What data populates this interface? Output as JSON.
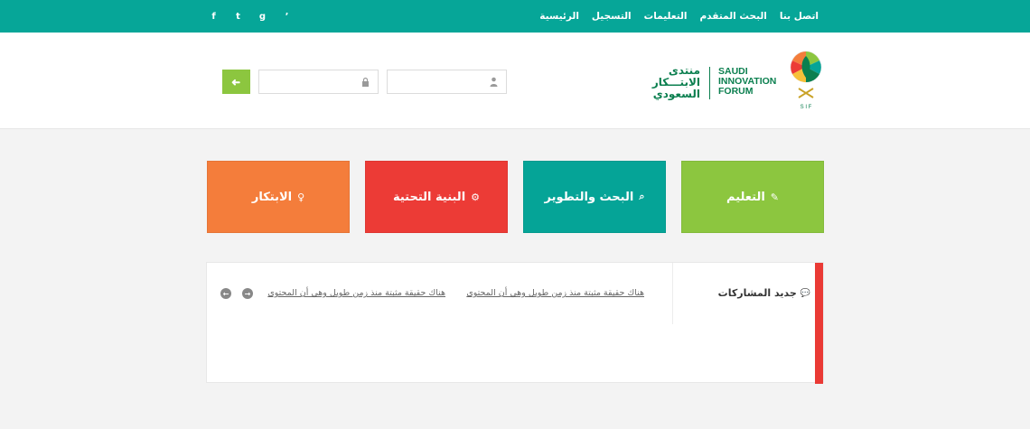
{
  "nav": {
    "items": [
      "الرئيسية",
      "التسجيل",
      "التعليمات",
      "البحث المتقدم",
      "اتصل بنا"
    ]
  },
  "social": {
    "icons": [
      "facebook-icon",
      "twitter-icon",
      "google-plus-icon",
      "rss-icon"
    ],
    "glyphs": [
      "f",
      "t",
      "g",
      "ʼ"
    ]
  },
  "logo": {
    "en_line1": "SAUDI",
    "en_line2": "INNOVATION",
    "en_line3": "FORUM",
    "ar_line1": "منتدى",
    "ar_line2": "الابتـــكار",
    "ar_line3": "السعودي",
    "mark_text": "S I F"
  },
  "login": {
    "username_placeholder": "",
    "password_placeholder": "",
    "submit_glyph": "➜"
  },
  "tiles": [
    {
      "label": "التعليم",
      "icon": "pencil-icon",
      "color": "#8cc63f"
    },
    {
      "label": "البحث والتطوير",
      "icon": "search-icon",
      "color": "#05a497"
    },
    {
      "label": "البنية التحتية",
      "icon": "gear-icon",
      "color": "#ec3b36"
    },
    {
      "label": "الابتكار",
      "icon": "lightbulb-icon",
      "color": "#f47d3b"
    }
  ],
  "posts": {
    "title": "جديد المشاركات",
    "items": [
      "هناك حقيقة مثبتة منذ زمن طويل وهي أن المحتوى",
      "هناك حقيقة مثبتة منذ زمن طويل وهي أن المحتوى"
    ]
  },
  "colors": {
    "topbar": "#06a698",
    "accent_green": "#8cc63f",
    "panel_bar": "#ea3a35"
  }
}
